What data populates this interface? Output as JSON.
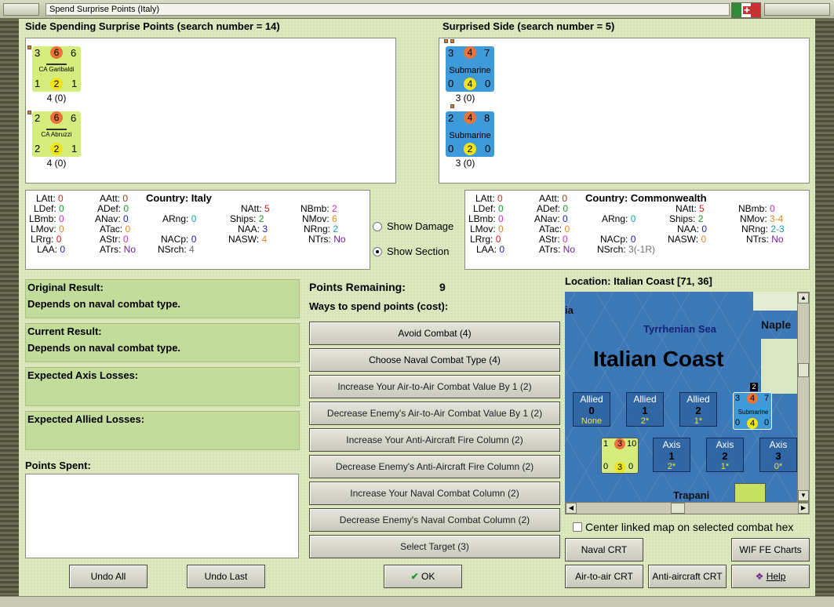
{
  "window": {
    "title": "Spend Surprise Points (Italy)"
  },
  "spending": {
    "header": "Side Spending Surprise Points (search number = 14)",
    "units": [
      {
        "name": "CA Garibaldi",
        "tl": "3",
        "tc": "6",
        "tr": "6",
        "bl": "1",
        "bc": "2",
        "br": "1",
        "caption": "4 (0)"
      },
      {
        "name": "CA Abruzzi",
        "tl": "2",
        "tc": "6",
        "tr": "6",
        "bl": "2",
        "bc": "2",
        "br": "1",
        "caption": "4 (0)"
      }
    ]
  },
  "surprised": {
    "header": "Surprised Side (search number = 5)",
    "units": [
      {
        "name": "Submarine",
        "tl": "3",
        "tc": "4",
        "tr": "7",
        "bl": "0",
        "bc": "4",
        "br": "0",
        "caption": "3 (0)"
      },
      {
        "name": "Submarine",
        "tl": "2",
        "tc": "4",
        "tr": "8",
        "bl": "0",
        "bc": "2",
        "br": "0",
        "caption": "3 (0)"
      }
    ]
  },
  "stats_italy": {
    "country_label": "Country:",
    "country": "Italy",
    "LAtt": "0",
    "LDef": "0",
    "LBmb": "0",
    "LMov": "0",
    "LRrg": "0",
    "LAA": "0",
    "AAtt": "0",
    "ADef": "0",
    "ANav": "0",
    "ATac": "0",
    "AStr": "0",
    "ATrs": "No",
    "ARng": "0",
    "NACp": "0",
    "NSrch": "4",
    "NAtt": "5",
    "Ships": "2",
    "NAA": "3",
    "NASW": "4",
    "NBmb": "2",
    "NMov": "6",
    "NRng": "2",
    "NTrs": "No"
  },
  "stats_cw": {
    "country_label": "Country:",
    "country": "Commonwealth",
    "LAtt": "0",
    "LDef": "0",
    "LBmb": "0",
    "LMov": "0",
    "LRrg": "0",
    "LAA": "0",
    "AAtt": "0",
    "ADef": "0",
    "ANav": "0",
    "ATac": "0",
    "AStr": "0",
    "ATrs": "No",
    "ARng": "0",
    "NACp": "0",
    "NSrch": "3(-1R)",
    "NAtt": "5",
    "Ships": "2",
    "NAA": "0",
    "NASW": "0",
    "NBmb": "0",
    "NMov": "3-4",
    "NRng": "2-3",
    "NTrs": "No"
  },
  "options": {
    "show_damage": "Show Damage",
    "show_section": "Show Section",
    "selected": "Show Section"
  },
  "results": {
    "original_label": "Original Result:",
    "original_value": "Depends on naval combat type.",
    "current_label": "Current Result:",
    "current_value": "Depends on naval combat type.",
    "axis_losses_label": "Expected Axis Losses:",
    "allied_losses_label": "Expected Allied Losses:",
    "points_spent_label": "Points Spent:"
  },
  "points": {
    "remaining_label": "Points Remaining:",
    "remaining_value": "9",
    "ways_label": "Ways to spend points (cost):",
    "options": [
      "Avoid Combat (4)",
      "Choose Naval Combat Type (4)",
      "Increase Your Air-to-Air Combat Value By 1 (2)",
      "Decrease Enemy's Air-to-Air Combat Value By 1 (2)",
      "Increase Your Anti-Aircraft Fire Column (2)",
      "Decrease Enemy's Anti-Aircraft Fire Column (2)",
      "Increase Your Naval Combat Column (2)",
      "Decrease Enemy's Naval Combat Column (2)",
      "Select Target (3)"
    ]
  },
  "map": {
    "location": "Location: Italian Coast [71, 36]",
    "sea_label": "Tyrrhenian Sea",
    "coast_label": "Italian Coast",
    "naples_label": "Naple",
    "ia_label": "ia",
    "trapani_label": "Trapani",
    "allied_boxes": [
      {
        "t": "Allied",
        "b": "0",
        "s": "None"
      },
      {
        "t": "Allied",
        "b": "1",
        "s": "2*"
      },
      {
        "t": "Allied",
        "b": "2",
        "s": "1*"
      }
    ],
    "axis_boxes": [
      {
        "t": "Axis",
        "b": "1",
        "s": "2*"
      },
      {
        "t": "Axis",
        "b": "2",
        "s": "1*"
      },
      {
        "t": "Axis",
        "b": "3",
        "s": "0*"
      }
    ],
    "sub_counter": {
      "name": "Submarine",
      "tl": "3",
      "tc": "4",
      "tr": "7",
      "bl": "0",
      "bc": "4",
      "br": "0",
      "stack": "2"
    },
    "ita_counter": {
      "tl": "1",
      "tc": "3",
      "tr": "10",
      "bl": "0",
      "bc": "3",
      "br": "0"
    },
    "center_linked": "Center linked map on selected combat hex"
  },
  "buttons": {
    "undo_all": "Undo All",
    "undo_last": "Undo Last",
    "ok": "OK",
    "naval_crt": "Naval CRT",
    "wif_fe_charts": "WIF FE Charts",
    "air_to_air_crt": "Air-to-air CRT",
    "anti_aircraft_crt": "Anti-aircraft CRT",
    "help": "Help"
  },
  "colors": {
    "panel_green": "#c2dc9c",
    "italy_counter": "#d6ec7c",
    "cw_counter": "#3e9ad8",
    "sea": "#3c78b6"
  }
}
